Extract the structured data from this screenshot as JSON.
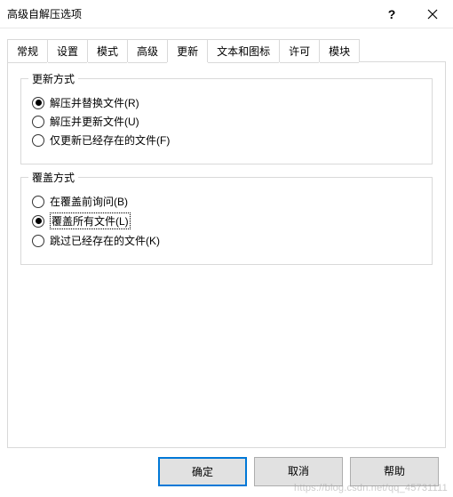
{
  "window": {
    "title": "高级自解压选项"
  },
  "tabs": {
    "items": [
      {
        "label": "常规"
      },
      {
        "label": "设置"
      },
      {
        "label": "模式"
      },
      {
        "label": "高级"
      },
      {
        "label": "更新"
      },
      {
        "label": "文本和图标"
      },
      {
        "label": "许可"
      },
      {
        "label": "模块"
      }
    ],
    "active_index": 4
  },
  "update_mode": {
    "legend": "更新方式",
    "options": [
      {
        "label": "解压并替换文件(R)",
        "checked": true
      },
      {
        "label": "解压并更新文件(U)",
        "checked": false
      },
      {
        "label": "仅更新已经存在的文件(F)",
        "checked": false
      }
    ]
  },
  "overwrite_mode": {
    "legend": "覆盖方式",
    "options": [
      {
        "label": "在覆盖前询问(B)",
        "checked": false
      },
      {
        "label": "覆盖所有文件(L)",
        "checked": true,
        "focused": true
      },
      {
        "label": "跳过已经存在的文件(K)",
        "checked": false
      }
    ]
  },
  "buttons": {
    "ok": "确定",
    "cancel": "取消",
    "help": "帮助"
  },
  "watermark": "https://blog.csdn.net/qq_45731111"
}
